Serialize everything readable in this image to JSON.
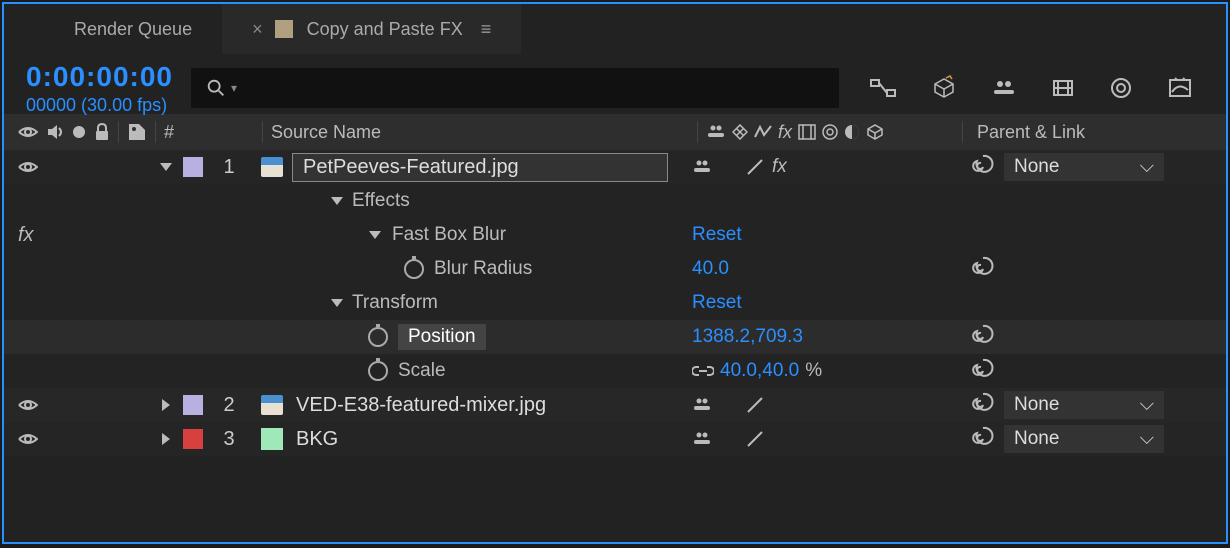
{
  "tabs": {
    "queue": "Render Queue",
    "active_label": "Copy and Paste FX"
  },
  "time": {
    "code": "0:00:00:00",
    "frames": "00000 (30.00 fps)"
  },
  "columns": {
    "hash": "#",
    "source": "Source Name",
    "parent": "Parent & Link"
  },
  "layers": [
    {
      "num": "1",
      "name": "PetPeeves-Featured.jpg",
      "parent": "None",
      "color": "#b8b0e0"
    },
    {
      "num": "2",
      "name": "VED-E38-featured-mixer.jpg",
      "parent": "None",
      "color": "#b8b0e0"
    },
    {
      "num": "3",
      "name": "BKG",
      "parent": "None",
      "color": "#d84040"
    }
  ],
  "groups": {
    "effects": "Effects",
    "fastbox": "Fast Box Blur",
    "fastbox_reset": "Reset",
    "blur_radius_label": "Blur Radius",
    "blur_radius_value": "40.0",
    "transform": "Transform",
    "transform_reset": "Reset",
    "position_label": "Position",
    "position_value": "1388.2,709.3",
    "scale_label": "Scale",
    "scale_value": "40.0,40.0",
    "scale_unit": "%"
  }
}
